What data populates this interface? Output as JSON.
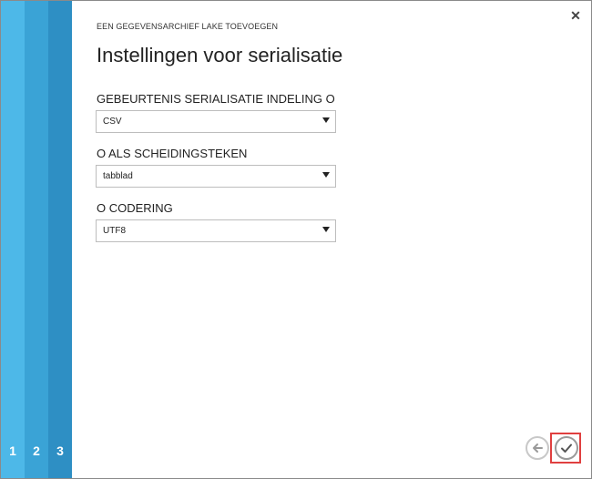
{
  "wizard": {
    "title": "EEN GEGEVENSARCHIEF LAKE TOEVOEGEN",
    "close_icon": "close-icon"
  },
  "page": {
    "title": "Instellingen voor serialisatie"
  },
  "steps": [
    "1",
    "2",
    "3"
  ],
  "fields": [
    {
      "label": "GEBEURTENIS SERIALISATIE INDELING O",
      "value": "CSV"
    },
    {
      "label": "O ALS SCHEIDINGSTEKEN",
      "value": "tabblad"
    },
    {
      "label": "O CODERING",
      "value": "UTF8"
    }
  ],
  "footer": {
    "back_icon": "arrow-left-icon",
    "done_icon": "checkmark-icon",
    "highlight_color": "#e04040"
  }
}
